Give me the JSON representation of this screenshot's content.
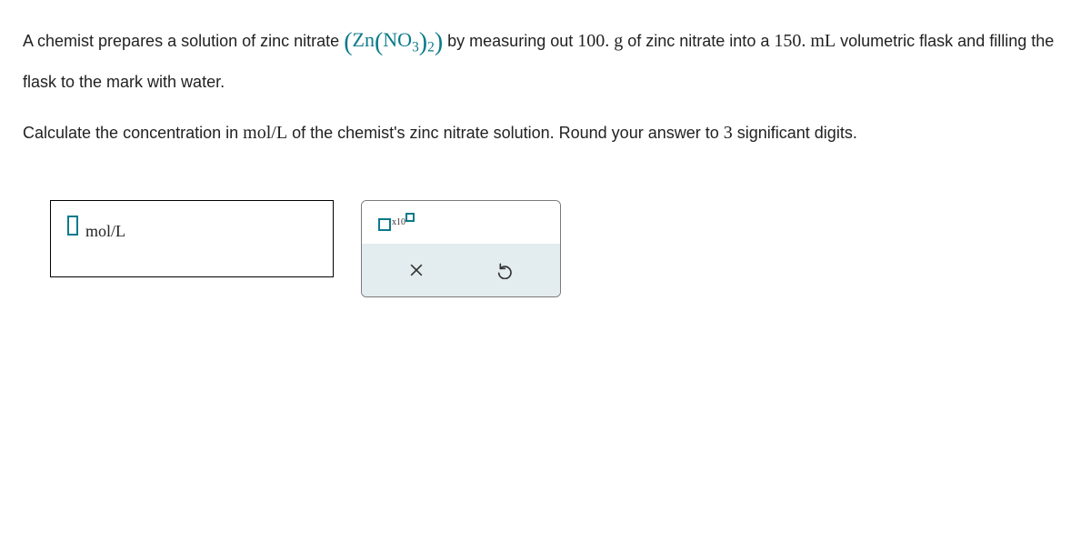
{
  "question": {
    "part1_before": "A chemist prepares a solution of zinc nitrate ",
    "formula_left": "Zn",
    "formula_right": "NO",
    "formula_sub1": "3",
    "formula_sub2": "2",
    "part1_after": " by measuring out ",
    "mass": "100.",
    "mass_unit": " g",
    "part1_after2": " of zinc nitrate into a ",
    "volume": "150.",
    "volume_unit": " mL",
    "part1_end": " volumetric flask and filling the flask to the mark with water.",
    "part2_before": "Calculate the concentration in ",
    "conc_unit": "mol/L",
    "part2_mid": " of the chemist's zinc nitrate solution. Round your answer to ",
    "sig_figs": "3",
    "part2_end": " significant digits."
  },
  "answer": {
    "unit": "mol/L",
    "x10_label": "x10"
  }
}
